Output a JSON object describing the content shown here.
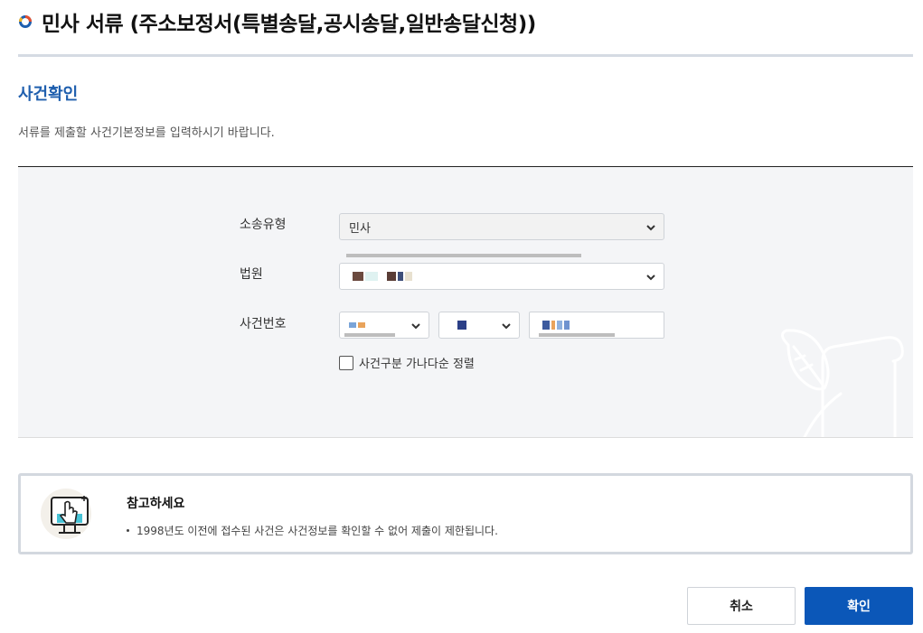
{
  "page": {
    "title": "민사 서류 (주소보정서(특별송달,공시송달,일반송달신청))"
  },
  "section": {
    "title": "사건확인",
    "description": "서류를 제출할 사건기본정보를 입력하시기 바랍니다."
  },
  "form": {
    "lawsuit_type_label": "소송유형",
    "lawsuit_type_value": "민사",
    "court_label": "법원",
    "case_number_label": "사건번호",
    "sort_checkbox_label": "사건구분 가나다순 정렬",
    "sort_checked": false
  },
  "notice": {
    "title": "참고하세요",
    "items": [
      "1998년도 이전에 접수된 사건은 사건정보를 확인할 수 없어 제출이 제한됩니다."
    ]
  },
  "buttons": {
    "cancel_label": "취소",
    "confirm_label": "확인"
  },
  "colors": {
    "primary": "#0b57b8",
    "section_title": "#1f5fae"
  }
}
